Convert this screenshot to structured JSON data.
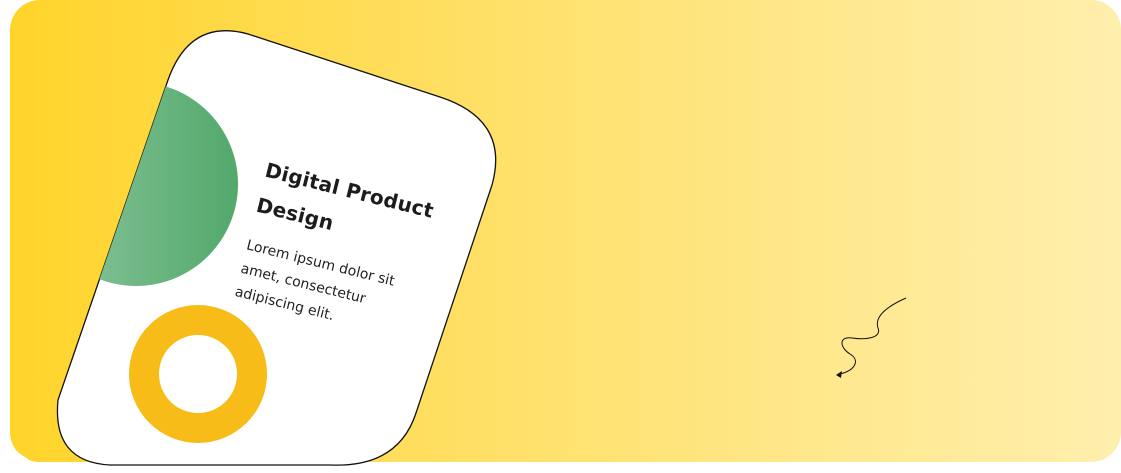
{
  "card": {
    "title": "Digital Product Design",
    "body": "Lorem ipsum dolor sit amet, consectetur adipiscing elit."
  },
  "colors": {
    "banner_start": "#ffd42a",
    "banner_end": "#ffefad",
    "green_shape": "#52a86c",
    "ring": "#f7bc17",
    "card": "#ffffff",
    "outline": "#111111"
  },
  "icons": {
    "squiggle": "squiggle-arrow-icon"
  }
}
